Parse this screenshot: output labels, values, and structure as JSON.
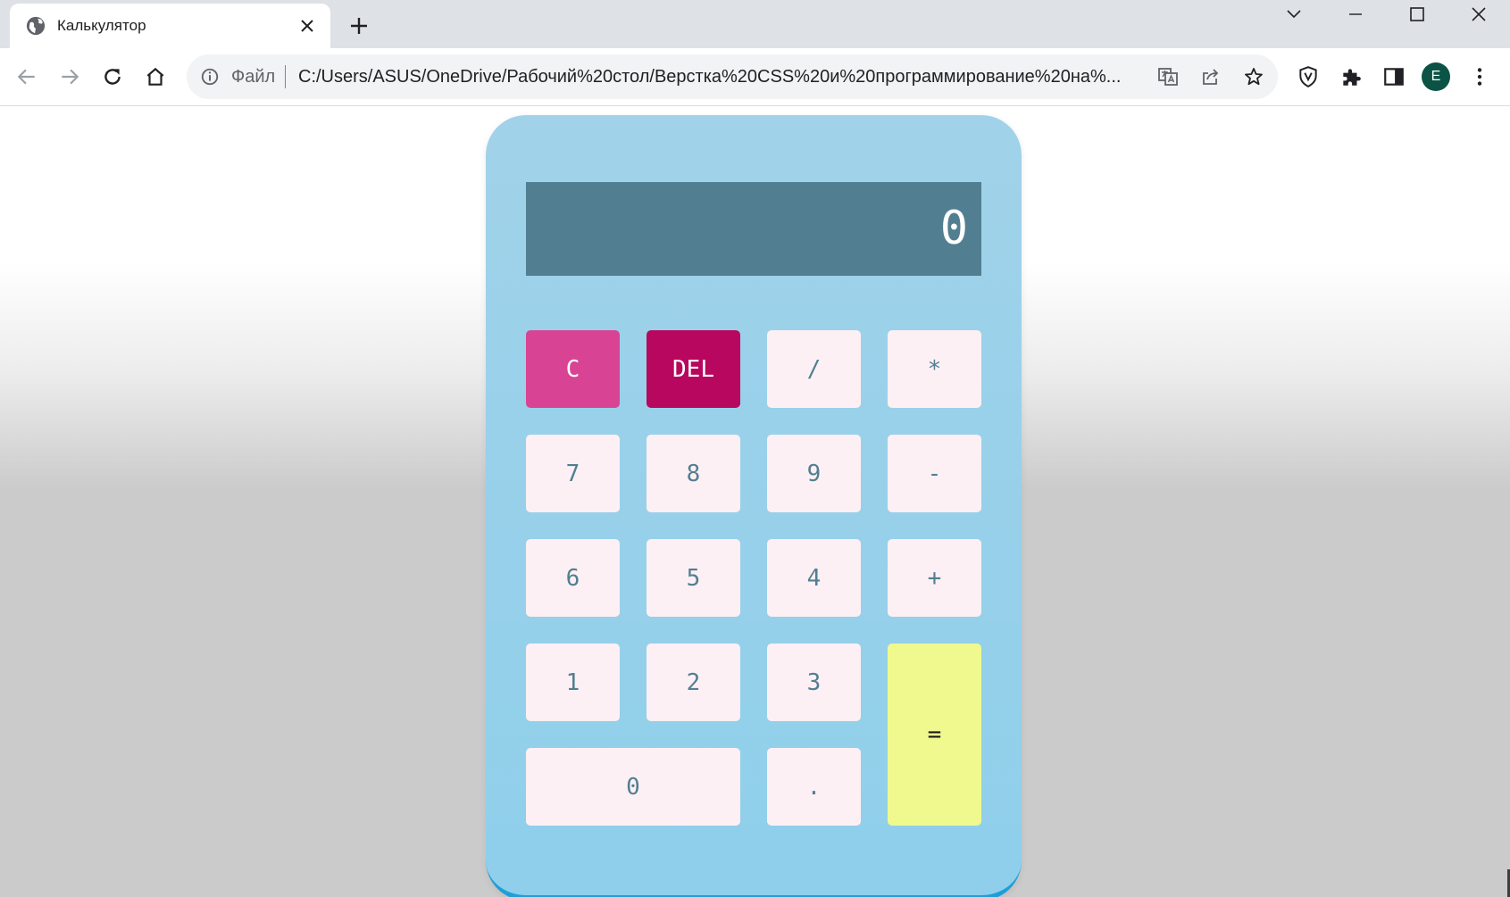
{
  "browser": {
    "tab": {
      "title": "Калькулятор",
      "favicon": "globe-icon",
      "close_icon": "close-icon"
    },
    "new_tab_icon": "plus-icon",
    "window_controls": [
      "chevron-down-icon",
      "minimize-icon",
      "maximize-icon",
      "close-icon"
    ],
    "nav": {
      "back_icon": "arrow-left-icon",
      "forward_icon": "arrow-right-icon",
      "reload_icon": "reload-icon",
      "home_icon": "home-icon"
    },
    "omnibox": {
      "info_icon": "info-icon",
      "prefix": "Файл",
      "url": "C:/Users/ASUS/OneDrive/Рабочий%20стол/Верстка%20CSS%20и%20программирование%20на%...",
      "actions": [
        "translate-icon",
        "share-icon",
        "star-icon"
      ]
    },
    "extensions": [
      "shield-v-icon",
      "puzzle-icon",
      "sidepanel-icon"
    ],
    "avatar_letter": "E",
    "menu_icon": "kebab-menu-icon"
  },
  "calculator": {
    "display": "0",
    "keys": {
      "clear": "C",
      "del": "DEL",
      "divide": "/",
      "multiply": "*",
      "seven": "7",
      "eight": "8",
      "nine": "9",
      "minus": "-",
      "six": "6",
      "five": "5",
      "four": "4",
      "plus": "+",
      "one": "1",
      "two": "2",
      "three": "3",
      "equals": "=",
      "zero": "0",
      "dot": "."
    },
    "colors": {
      "body": "#9fd3ea",
      "display": "#517f91",
      "key": "#fdf0f4",
      "key_text": "#517f91",
      "clear": "#d94393",
      "del": "#b8075f",
      "equals": "#eff98e"
    }
  }
}
